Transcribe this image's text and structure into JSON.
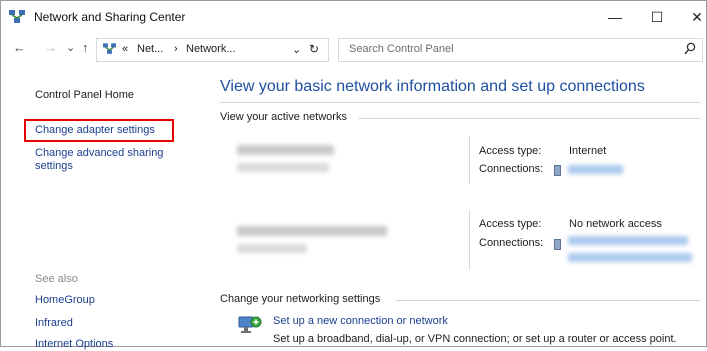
{
  "window": {
    "title": "Network and Sharing Center",
    "controls": {
      "minimize": "—",
      "maximize": "☐",
      "close": "✕"
    }
  },
  "nav": {
    "back": "←",
    "forward": "→",
    "history": "⌄",
    "up": "↑",
    "breadcrumb": {
      "overflow": "«",
      "item1": "Net...",
      "sep": "›",
      "item2": "Network...",
      "dropdown": "⌄",
      "refresh": "↻"
    },
    "search_placeholder": "Search Control Panel"
  },
  "sidebar": {
    "home": "Control Panel Home",
    "links": [
      "Change adapter settings",
      "Change advanced sharing settings"
    ],
    "see_also_title": "See also",
    "see_also": [
      "HomeGroup",
      "Infrared",
      "Internet Options"
    ]
  },
  "main": {
    "heading": "View your basic network information and set up connections",
    "active_networks_title": "View your active networks",
    "networks": [
      {
        "access_type_label": "Access type:",
        "access_type": "Internet",
        "connections_label": "Connections:"
      },
      {
        "access_type_label": "Access type:",
        "access_type": "No network access",
        "connections_label": "Connections:"
      }
    ],
    "change_settings_title": "Change your networking settings",
    "tasks": [
      {
        "link": "Set up a new connection or network",
        "description": "Set up a broadband, dial-up, or VPN connection; or set up a router or access point."
      }
    ]
  },
  "colors": {
    "link": "#1a3f8f",
    "heading": "#1e4fa0",
    "highlight_box": "#e60000"
  }
}
